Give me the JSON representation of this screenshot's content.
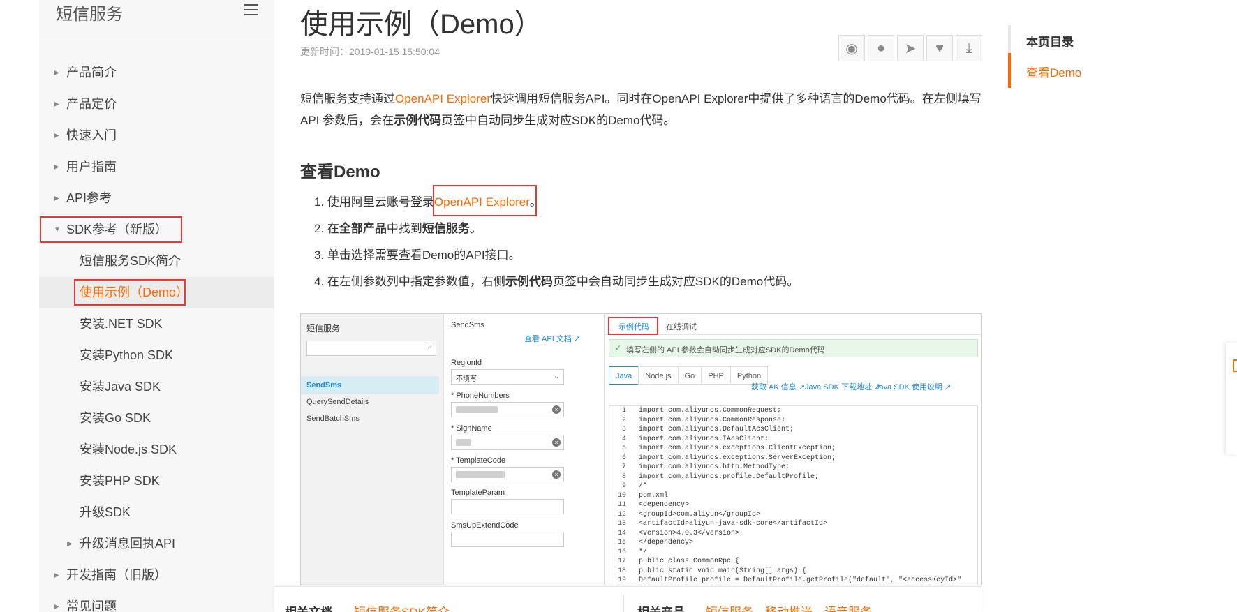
{
  "sidebar": {
    "title": "短信服务",
    "items": [
      {
        "label": "产品简介",
        "arrow": "▶"
      },
      {
        "label": "产品定价",
        "arrow": "▶"
      },
      {
        "label": "快速入门",
        "arrow": "▶"
      },
      {
        "label": "用户指南",
        "arrow": "▶"
      },
      {
        "label": "API参考",
        "arrow": "▶"
      },
      {
        "label": "SDK参考（新版）",
        "arrow": "▼"
      },
      {
        "label": "短信服务SDK简介"
      },
      {
        "label": "使用示例（Demo）"
      },
      {
        "label": "安装.NET SDK"
      },
      {
        "label": "安装Python SDK"
      },
      {
        "label": "安装Java SDK"
      },
      {
        "label": "安装Go SDK"
      },
      {
        "label": "安装Node.js SDK"
      },
      {
        "label": "安装PHP SDK"
      },
      {
        "label": "升级SDK"
      },
      {
        "label": "升级消息回执API",
        "arrow": "▶"
      },
      {
        "label": "开发指南（旧版）",
        "arrow": "▶"
      },
      {
        "label": "常见问题",
        "arrow": "▶"
      }
    ]
  },
  "article": {
    "title": "使用示例（Demo）",
    "updated": "更新时间：2019-01-15 15:50:04",
    "share_icons": [
      "weibo-icon",
      "wechat-icon",
      "dingtalk-icon",
      "heart-icon",
      "download-icon"
    ],
    "intro": {
      "p1": "短信服务支持通过",
      "link": "OpenAPI Explorer",
      "p2": "快速调用短信服务API。同时在OpenAPI Explorer中提供了多种语言的Demo代码。在左侧填写API 参数后，会在",
      "bold": "示例代码",
      "p3": "页签中自动同步生成对应SDK的Demo代码。"
    },
    "section_title": "查看Demo",
    "steps": {
      "s1_pre": "1. 使用阿里云账号登录",
      "s1_link": "OpenAPI Explorer",
      "s1_post": "。",
      "s2_a": "2. 在",
      "s2_b": "全部产品",
      "s2_c": "中找到",
      "s2_d": "短信服务",
      "s2_e": "。",
      "s3": "3. 单击选择需要查看Demo的API接口。",
      "s4_a": "4. 在左侧参数列中指定参数值，右侧",
      "s4_b": "示例代码",
      "s4_c": "页签中会自动同步生成对应SDK的Demo代码。"
    }
  },
  "figure": {
    "col1_title": "短信服务",
    "api_list": [
      "SendSms",
      "QuerySendDetails",
      "SendBatchSms"
    ],
    "col2_title": "SendSms",
    "api_doc_link": "查看 API 文档",
    "params": {
      "region": "RegionId",
      "region_value": "不填写",
      "phone": "* PhoneNumbers",
      "sign": "* SignName",
      "template": "* TemplateCode",
      "template_param": "TemplateParam",
      "up_extend": "SmsUpExtendCode"
    },
    "tab_code": "示例代码",
    "tab_debug": "在线调试",
    "notice": "填写左侧的 API 参数会自动同步生成对应SDK的Demo代码",
    "langs": [
      "Java",
      "Node.js",
      "Go",
      "PHP",
      "Python"
    ],
    "link_ak": "获取 AK 信息",
    "link_download": "Java SDK 下载地址",
    "link_usage": "Java SDK 使用说明",
    "code_lines": [
      {
        "n": "1",
        "t": "import com.aliyuncs.CommonRequest;"
      },
      {
        "n": "2",
        "t": "import com.aliyuncs.CommonResponse;"
      },
      {
        "n": "3",
        "t": "import com.aliyuncs.DefaultAcsClient;"
      },
      {
        "n": "4",
        "t": "import com.aliyuncs.IAcsClient;"
      },
      {
        "n": "5",
        "t": "import com.aliyuncs.exceptions.ClientException;"
      },
      {
        "n": "6",
        "t": "import com.aliyuncs.exceptions.ServerException;"
      },
      {
        "n": "7",
        "t": "import com.aliyuncs.http.MethodType;"
      },
      {
        "n": "8",
        "t": "import com.aliyuncs.profile.DefaultProfile;"
      },
      {
        "n": "9",
        "t": "/*"
      },
      {
        "n": "10",
        "t": "pom.xml"
      },
      {
        "n": "11",
        "t": "<dependency>"
      },
      {
        "n": "12",
        "t": "  <groupId>com.aliyun</groupId>"
      },
      {
        "n": "13",
        "t": "  <artifactId>aliyun-java-sdk-core</artifactId>"
      },
      {
        "n": "14",
        "t": "  <version>4.0.3</version>"
      },
      {
        "n": "15",
        "t": "</dependency>"
      },
      {
        "n": "16",
        "t": "*/"
      },
      {
        "n": "17",
        "t": "public class CommonRpc {"
      },
      {
        "n": "18",
        "t": "    public static void main(String[] args) {"
      },
      {
        "n": "19",
        "t": "        DefaultProfile profile = DefaultProfile.getProfile(\"default\", \"<accessKeyId>\""
      }
    ]
  },
  "bottom": {
    "related_docs": "相关文档",
    "doc_link": "短信服务SDK简介",
    "related_products": "相关产品",
    "products": [
      "短信服务",
      "移动推送",
      "语音服务"
    ]
  },
  "toc": {
    "title": "本页目录",
    "items": [
      "查看Demo"
    ]
  },
  "colors": {
    "accent": "#ff6a00",
    "highlight_box": "#e53935",
    "link_blue": "#1e88e5"
  }
}
